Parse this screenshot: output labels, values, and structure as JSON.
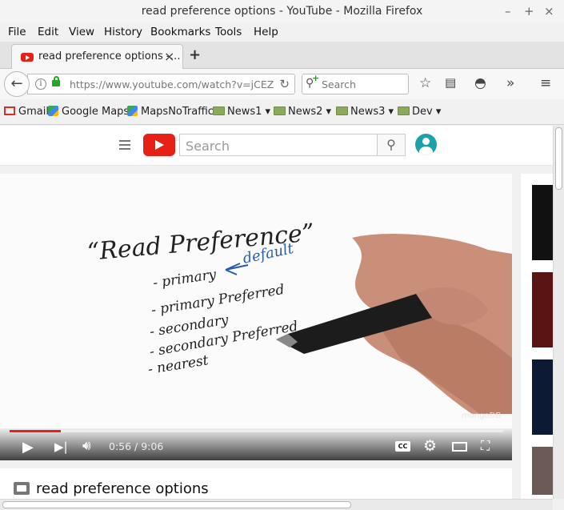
{
  "window": {
    "title": "read preference options - YouTube - Mozilla Firefox",
    "controls": [
      "–",
      "+",
      "×"
    ]
  },
  "menu": {
    "file": "File",
    "edit": "Edit",
    "view": "View",
    "history": "History",
    "bookmarks": "Bookmarks",
    "tools": "Tools",
    "help": "Help"
  },
  "tab": {
    "label": "read preference options -…",
    "close": "×",
    "new_tab": "+"
  },
  "nav": {
    "url": "https://www.youtube.com/watch?v=jCEZV",
    "search_placeholder": "Search"
  },
  "bookmarks": [
    {
      "label": "Gmail",
      "icon": "gmail-icon"
    },
    {
      "label": "Google Maps",
      "icon": "maps-icon"
    },
    {
      "label": "MapsNoTraffic",
      "icon": "maps-icon"
    },
    {
      "label": "News1",
      "icon": "folder-icon"
    },
    {
      "label": "News2",
      "icon": "folder-icon"
    },
    {
      "label": "News3",
      "icon": "folder-icon"
    },
    {
      "label": "Dev",
      "icon": "folder-icon"
    }
  ],
  "youtube": {
    "search_placeholder": "Search",
    "video": {
      "time": "0:56 / 9:06",
      "progress_fraction": 0.103,
      "watermark": "mongoDB",
      "board": {
        "heading": "“Read Preference”",
        "annotation": "default",
        "items": [
          "- primary",
          "- primary Preferred",
          "- secondary",
          "- secondary Preferred",
          "- nearest"
        ]
      }
    },
    "video_title": "read preference options"
  },
  "colors": {
    "youtube_red": "#e62117",
    "lock_green": "#2da12d",
    "avatar_teal": "#1aa1a9"
  }
}
